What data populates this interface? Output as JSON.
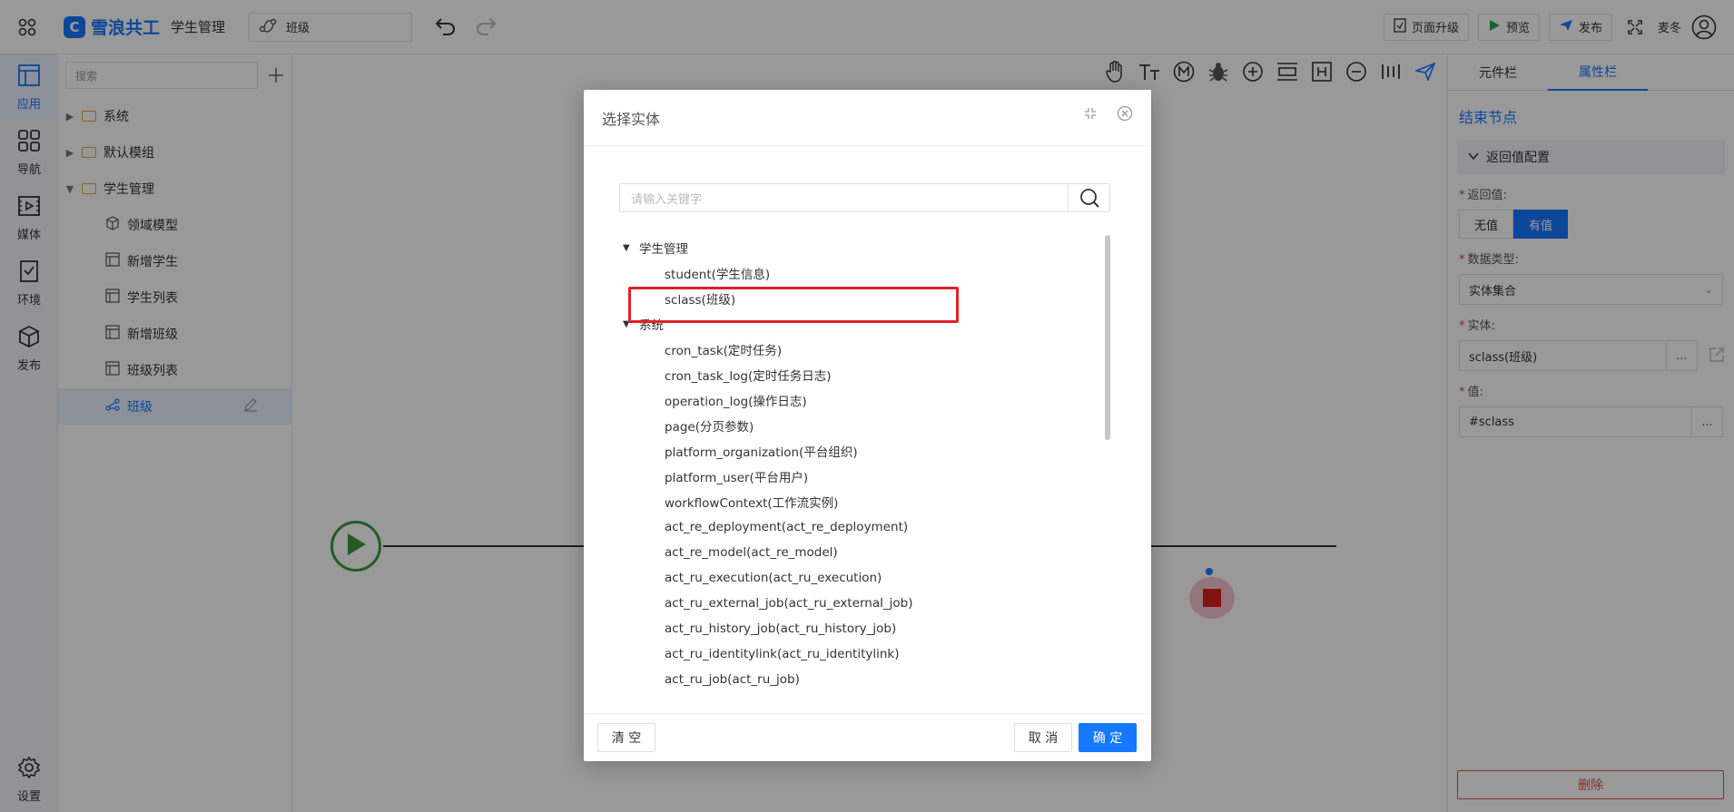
{
  "topbar": {
    "brand": "雪浪共工",
    "brand_logo_char": "C",
    "app_name": "学生管理",
    "flow_name": "班级",
    "upgrade_label": "页面升级",
    "preview_label": "预览",
    "publish_label": "发布",
    "user_name": "麦冬"
  },
  "rail": {
    "items": [
      {
        "label": "应用",
        "icon": "layout-icon",
        "active": true
      },
      {
        "label": "导航",
        "icon": "grid-icon"
      },
      {
        "label": "媒体",
        "icon": "media-icon"
      },
      {
        "label": "环境",
        "icon": "env-icon"
      },
      {
        "label": "发布",
        "icon": "cube-icon"
      }
    ],
    "settings_label": "设置"
  },
  "tree": {
    "search_placeholder": "搜索",
    "items": [
      {
        "label": "系统",
        "type": "folder",
        "expanded": false
      },
      {
        "label": "默认模组",
        "type": "folder",
        "expanded": false
      },
      {
        "label": "学生管理",
        "type": "folder",
        "expanded": true
      },
      {
        "label": "领域模型",
        "type": "model"
      },
      {
        "label": "新增学生",
        "type": "page"
      },
      {
        "label": "学生列表",
        "type": "page"
      },
      {
        "label": "新增班级",
        "type": "page"
      },
      {
        "label": "班级列表",
        "type": "page"
      },
      {
        "label": "班级",
        "type": "flow",
        "selected": true
      }
    ]
  },
  "props": {
    "tab_components": "元件栏",
    "tab_properties": "属性栏",
    "node_title": "结束节点",
    "section_title": "返回值配置",
    "return_label": "返回值:",
    "return_none": "无值",
    "return_has": "有值",
    "datatype_label": "数据类型:",
    "datatype_value": "实体集合",
    "entity_label": "实体:",
    "entity_value": "sclass(班级)",
    "value_label": "值:",
    "value_value": "#sclass",
    "more_label": "...",
    "delete_label": "删除"
  },
  "modal": {
    "title": "选择实体",
    "search_placeholder": "请输入关键字",
    "groups": [
      {
        "name": "学生管理",
        "items": [
          "student(学生信息)",
          "sclass(班级)"
        ]
      },
      {
        "name": "系统",
        "items": [
          "cron_task(定时任务)",
          "cron_task_log(定时任务日志)",
          "operation_log(操作日志)",
          "page(分页参数)",
          "platform_organization(平台组织)",
          "platform_user(平台用户)",
          "workflowContext(工作流实例)",
          "act_re_deployment(act_re_deployment)",
          "act_re_model(act_re_model)",
          "act_ru_execution(act_ru_execution)",
          "act_ru_external_job(act_ru_external_job)",
          "act_ru_history_job(act_ru_history_job)",
          "act_ru_identitylink(act_ru_identitylink)",
          "act_ru_job(act_ru_job)"
        ]
      }
    ],
    "clear_label": "清 空",
    "cancel_label": "取 消",
    "ok_label": "确 定"
  },
  "colors": {
    "accent": "#1677ff",
    "danger": "#e0202b",
    "start_green": "#3c9a3c"
  }
}
